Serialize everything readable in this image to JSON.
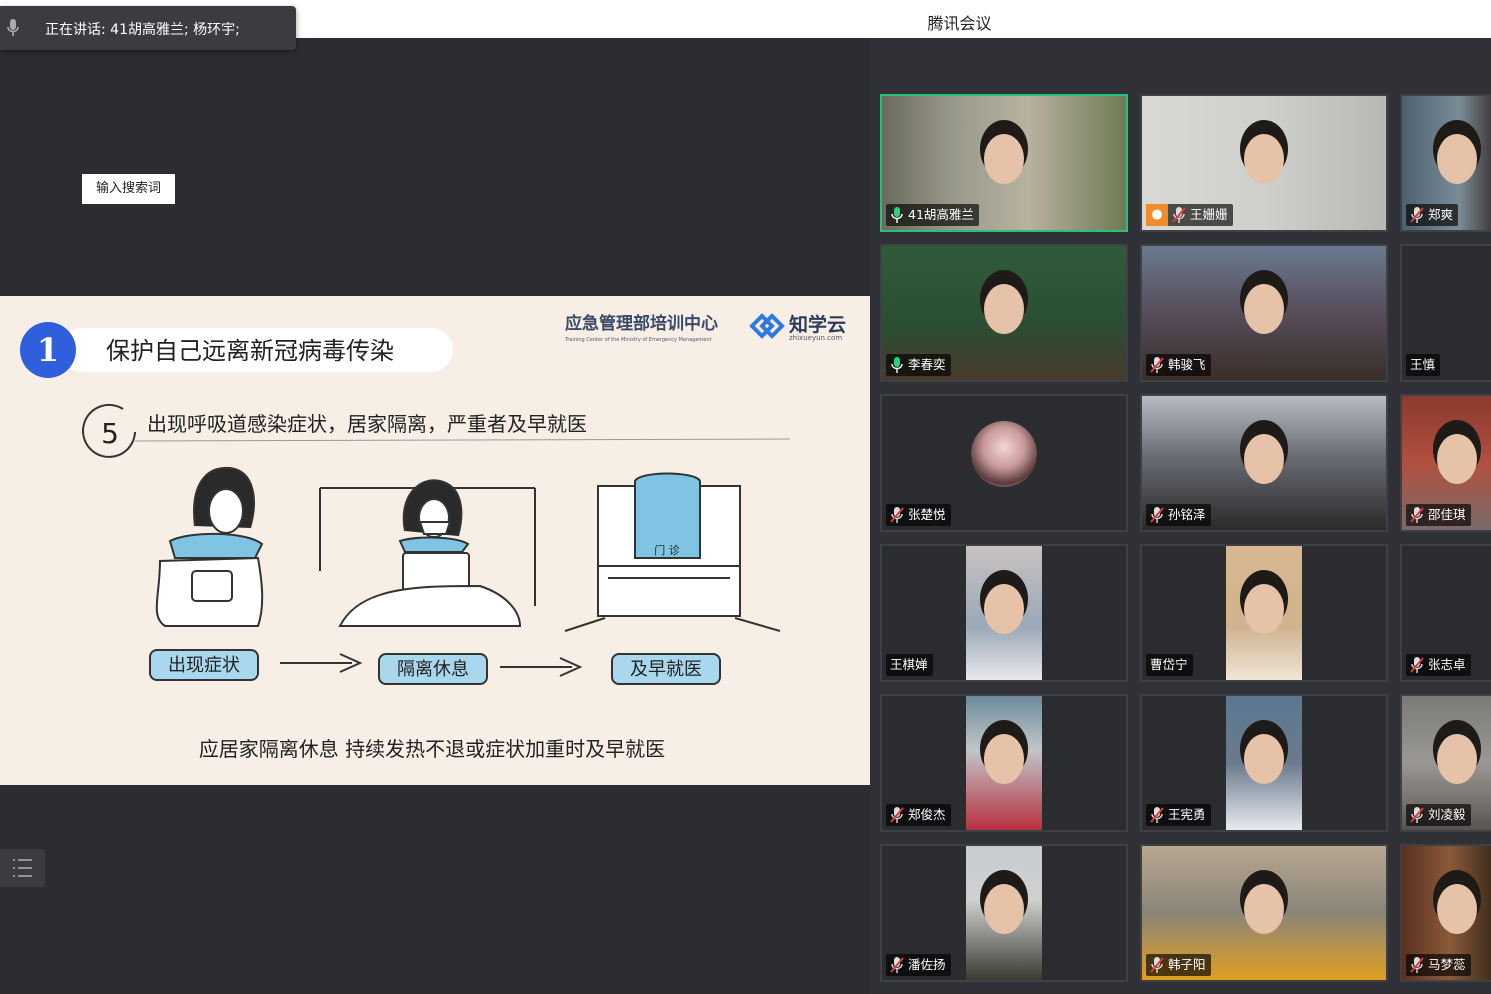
{
  "window": {
    "title": "腾讯会议"
  },
  "speaking": {
    "text": "正在讲话: 41胡高雅兰; 杨环宇;"
  },
  "share": {
    "search_placeholder": "输入搜索词",
    "slide": {
      "number": "1",
      "heading": "保护自己远离新冠病毒传染",
      "org_cn": "应急管理部培训中心",
      "org_en": "Training Center of the Ministry of Emergency Management",
      "brand_cn": "知学云",
      "brand_url": "zhixueyun.com",
      "step_number": "5",
      "step_text": "出现呼吸道感染症状，居家隔离，严重者及早就医",
      "door_sign": "门 诊",
      "flow": [
        "出现症状",
        "隔离休息",
        "及早就医"
      ],
      "footer": "应居家隔离休息  持续发热不退或症状加重时及早就医"
    }
  },
  "participants": [
    {
      "name": "41胡高雅兰",
      "mic": "on",
      "active": true
    },
    {
      "name": "王姗姗",
      "mic": "muted",
      "host_icon": true
    },
    {
      "name": "郑爽",
      "mic": "muted"
    },
    {
      "name": "李春奕",
      "mic": "on"
    },
    {
      "name": "韩骏飞",
      "mic": "muted"
    },
    {
      "name": "王慎",
      "mic": "none"
    },
    {
      "name": "张楚悦",
      "mic": "muted",
      "avatar": true
    },
    {
      "name": "孙铭泽",
      "mic": "muted"
    },
    {
      "name": "邵佳琪",
      "mic": "muted"
    },
    {
      "name": "王棋婵",
      "mic": "none"
    },
    {
      "name": "曹岱宁",
      "mic": "none"
    },
    {
      "name": "张志卓",
      "mic": "muted"
    },
    {
      "name": "郑俊杰",
      "mic": "muted"
    },
    {
      "name": "王宪勇",
      "mic": "muted"
    },
    {
      "name": "刘凌毅",
      "mic": "muted"
    },
    {
      "name": "潘佐扬",
      "mic": "muted"
    },
    {
      "name": "韩子阳",
      "mic": "muted"
    },
    {
      "name": "马梦蕊",
      "mic": "muted"
    }
  ]
}
